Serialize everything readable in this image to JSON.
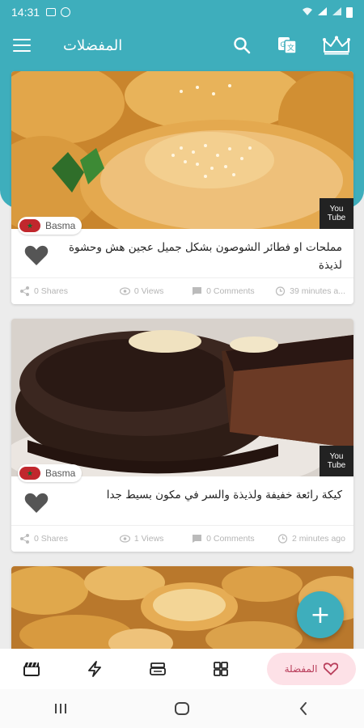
{
  "status_bar": {
    "time": "14:31"
  },
  "app_bar": {
    "title": "المفضلات"
  },
  "colors": {
    "primary": "#3eaebc",
    "accent_pink": "#fde1e7",
    "heart": "#555555"
  },
  "posts": [
    {
      "author": "Basma",
      "title": "مملحات او فطائر الشوصون بشكل جميل عجين هش وحشوة لذيذة",
      "shares": "0 Shares",
      "views": "0 Views",
      "comments": "0 Comments",
      "time": "39 minutes a..."
    },
    {
      "author": "Basma",
      "title": "كيكة رائعة خفيفة ولذيذة والسر في مكون بسيط جدا",
      "shares": "0 Shares",
      "views": "1 Views",
      "comments": "0 Comments",
      "time": "2 minutes ago"
    }
  ],
  "youtube_badge": {
    "line1": "You",
    "line2": "Tube"
  },
  "bottom_nav": {
    "active_label": "المفضلة",
    "icons": [
      "clapper-icon",
      "flash-icon",
      "bowl-icon",
      "grid-icon",
      "heart-icon"
    ]
  },
  "fab": {
    "label": "+"
  }
}
